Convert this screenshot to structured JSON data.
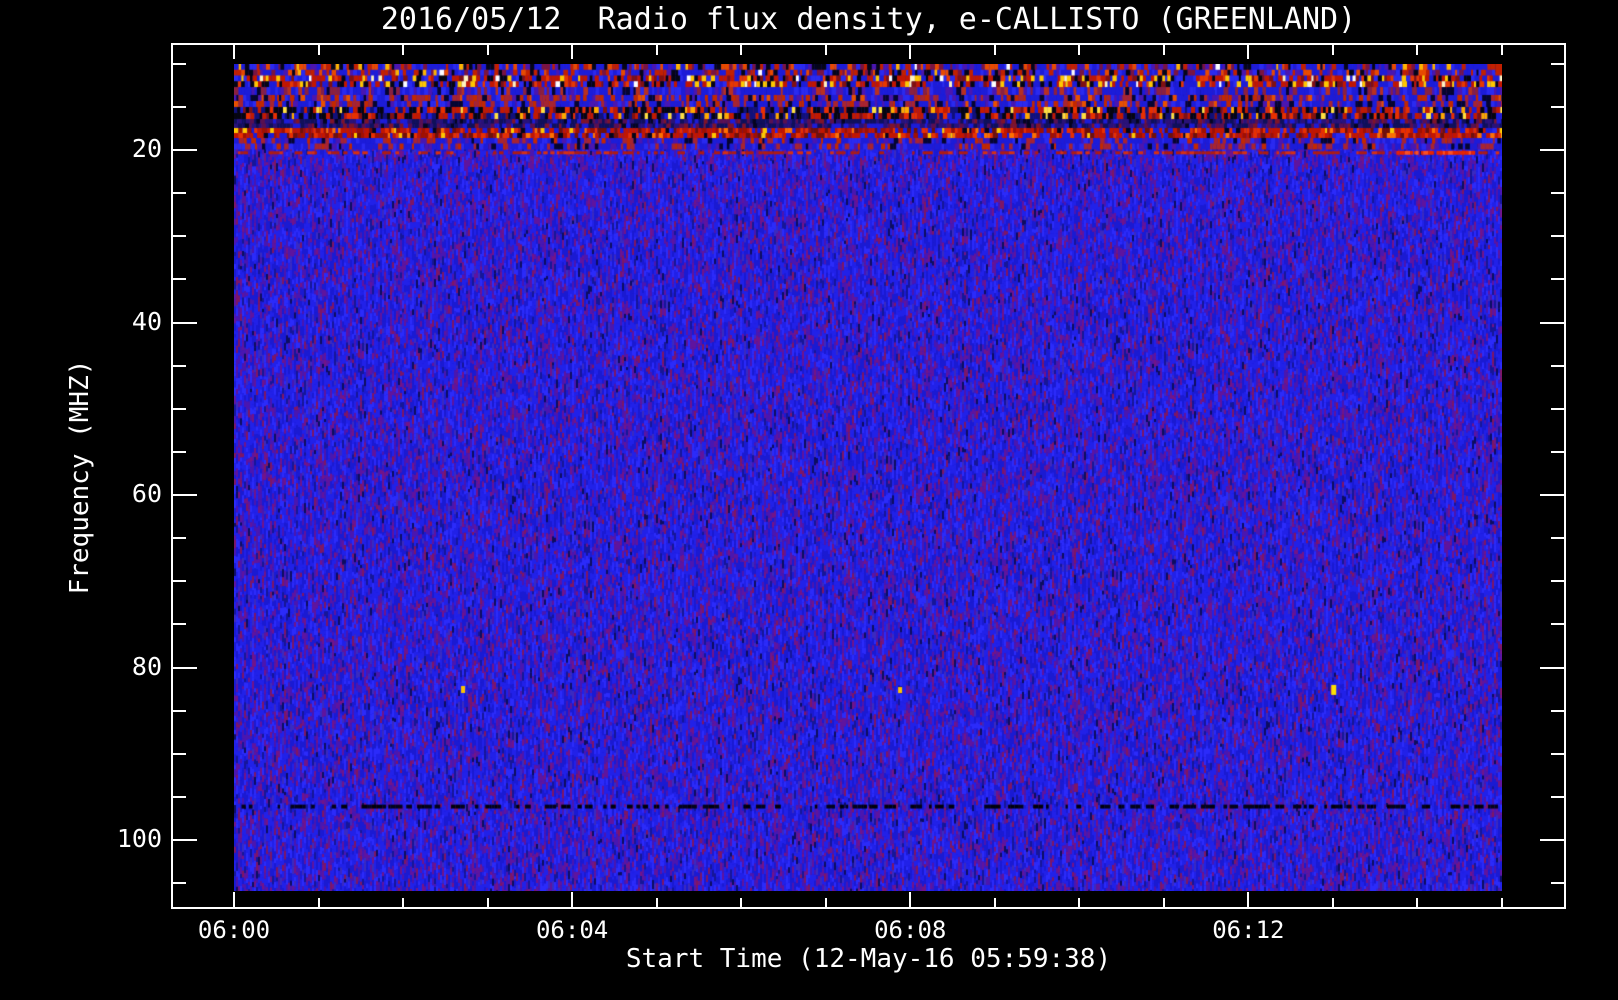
{
  "page": {
    "background_color": "#000000",
    "text_color": "#ffffff"
  },
  "chart_data": {
    "type": "heatmap",
    "title": "2016/05/12  Radio flux density, e-CALLISTO (GREENLAND)",
    "xlabel": "Start Time (12-May-16 05:59:38)",
    "ylabel": "Frequency (MHZ)",
    "legend": "none",
    "grid": "off",
    "x_axis": {
      "unit": "time UT",
      "start": "06:00",
      "end": "06:15",
      "minor_tick_every_minutes": 1,
      "major_ticks": [
        {
          "label": "06:00",
          "minute": 0
        },
        {
          "label": "06:04",
          "minute": 4
        },
        {
          "label": "06:08",
          "minute": 8
        },
        {
          "label": "06:12",
          "minute": 12
        }
      ]
    },
    "y_axis": {
      "unit": "MHz",
      "inverted": true,
      "frame_min_mhz": 7.6,
      "frame_max_mhz": 108.1,
      "data_min_mhz": 10.0,
      "data_max_mhz": 105.9,
      "minor_tick_every_mhz": 5,
      "major_ticks": [
        20,
        40,
        60,
        80,
        100
      ]
    },
    "background_noise": {
      "description": "quiet-sun blue noise floor with vertical purple streaks, no radio burst visible",
      "palette": [
        [
          "#2121e8",
          26
        ],
        [
          "#1a1ad2",
          20
        ],
        [
          "#2b2bfa",
          14
        ],
        [
          "#161698",
          5
        ],
        [
          "#4a16b0",
          12
        ],
        [
          "#5f149e",
          8
        ],
        [
          "#721488",
          6
        ],
        [
          "#7e1664",
          4
        ],
        [
          "#3a2ac0",
          4
        ],
        [
          "#0d0d60",
          2
        ]
      ]
    },
    "interference_bands": [
      {
        "name": "rfi-band-10.0-11.4MHz",
        "f0": 10.03,
        "f1": 11.36,
        "palette": [
          [
            "#1c1cd8",
            26
          ],
          [
            "#2a2af0",
            12
          ],
          [
            "#c22000",
            16
          ],
          [
            "#e84a00",
            8
          ],
          [
            "#050518",
            14
          ],
          [
            "#ffb400",
            4
          ],
          [
            "#ffffff",
            1
          ],
          [
            "#7a1440",
            10
          ],
          [
            "#4a16b0",
            9
          ]
        ]
      },
      {
        "name": "rfi-band-11.4-12.7MHz",
        "f0": 11.36,
        "f1": 12.7,
        "palette": [
          [
            "#050512",
            16
          ],
          [
            "#c21600",
            20
          ],
          [
            "#e83800",
            10
          ],
          [
            "#ffc800",
            9
          ],
          [
            "#fff4c0",
            3
          ],
          [
            "#ffffff",
            2
          ],
          [
            "#1c1cd8",
            20
          ],
          [
            "#2a2af0",
            8
          ],
          [
            "#801010",
            12
          ]
        ]
      },
      {
        "name": "rfi-band-12.7-13.6MHz",
        "f0": 12.7,
        "f1": 13.62,
        "palette": [
          [
            "#1c1cd8",
            40
          ],
          [
            "#2a2af0",
            18
          ],
          [
            "#8a2040",
            16
          ],
          [
            "#b83020",
            12
          ],
          [
            "#050530",
            6
          ],
          [
            "#4a16b0",
            8
          ]
        ]
      },
      {
        "name": "rfi-band-13.6-15.0MHz",
        "f0": 13.62,
        "f1": 15.01,
        "palette": [
          [
            "#1c1cd8",
            30
          ],
          [
            "#2a2af0",
            12
          ],
          [
            "#a82430",
            18
          ],
          [
            "#c22800",
            14
          ],
          [
            "#050530",
            10
          ],
          [
            "#e85000",
            4
          ],
          [
            "#4a16b0",
            12
          ]
        ]
      },
      {
        "name": "rfi-band-15.0-16.4MHz",
        "f0": 15.01,
        "f1": 16.41,
        "palette": [
          [
            "#050510",
            30
          ],
          [
            "#c21a00",
            16
          ],
          [
            "#e83000",
            8
          ],
          [
            "#ffaa00",
            6
          ],
          [
            "#ffe040",
            4
          ],
          [
            "#10107a",
            16
          ],
          [
            "#1c1cd8",
            14
          ],
          [
            "#801010",
            6
          ]
        ]
      },
      {
        "name": "rfi-band-16.4-17.5MHz",
        "f0": 16.41,
        "f1": 17.45,
        "palette": [
          [
            "#10105a",
            30
          ],
          [
            "#2a1278",
            22
          ],
          [
            "#5a1050",
            14
          ],
          [
            "#801428",
            10
          ],
          [
            "#1c1cd8",
            18
          ],
          [
            "#050520",
            6
          ]
        ]
      },
      {
        "name": "rfi-band-17.5-18.6MHz",
        "f0": 17.45,
        "f1": 18.61,
        "palette": [
          [
            "#c21600",
            30
          ],
          [
            "#a01000",
            14
          ],
          [
            "#e83000",
            14
          ],
          [
            "#ff7000",
            6
          ],
          [
            "#ffc800",
            3
          ],
          [
            "#701008",
            12
          ],
          [
            "#1c1cd8",
            14
          ],
          [
            "#050518",
            4
          ],
          [
            "#2a2af0",
            3
          ]
        ]
      },
      {
        "name": "rfi-band-18.6-19.9MHz",
        "f0": 18.61,
        "f1": 19.88,
        "palette": [
          [
            "#1c1cd8",
            38
          ],
          [
            "#2a2af0",
            14
          ],
          [
            "#a82430",
            16
          ],
          [
            "#c22800",
            10
          ],
          [
            "#4a16b0",
            14
          ],
          [
            "#050530",
            8
          ]
        ]
      }
    ],
    "artifacts": [
      {
        "kind": "line",
        "name": "red-interference-line",
        "f0": 20.15,
        "f1": 20.5,
        "t0": 0,
        "t1": 15,
        "palette": [
          [
            "#b01c10",
            30
          ],
          [
            "#d83010",
            16
          ],
          [
            "skip",
            54
          ]
        ]
      },
      {
        "kind": "line",
        "name": "red-interference-line-bright",
        "f0": 20.1,
        "f1": 20.55,
        "t0": 13.7,
        "t1": 14.7,
        "palette": [
          [
            "#e82400",
            64
          ],
          [
            "#ff5020",
            16
          ],
          [
            "skip",
            20
          ]
        ]
      },
      {
        "kind": "line",
        "name": "dark-dropout-line",
        "f0": 95.9,
        "f1": 96.35,
        "t0": 0,
        "t1": 15,
        "palette": [
          [
            "#030318",
            26
          ],
          [
            "#000008",
            22
          ],
          [
            "skip",
            52
          ]
        ]
      },
      {
        "kind": "dot",
        "name": "calibration-dot",
        "time_min": 2.71,
        "freq_mhz": 82.55,
        "w": 4,
        "h": 7,
        "color": "#ffc400"
      },
      {
        "kind": "dot",
        "name": "calibration-dot",
        "time_min": 7.88,
        "freq_mhz": 82.62,
        "w": 4,
        "h": 6,
        "color": "#ffc400"
      },
      {
        "kind": "dot",
        "name": "calibration-dot",
        "time_min": 13.01,
        "freq_mhz": 82.6,
        "w": 5,
        "h": 10,
        "color": "#ffe000"
      }
    ]
  }
}
